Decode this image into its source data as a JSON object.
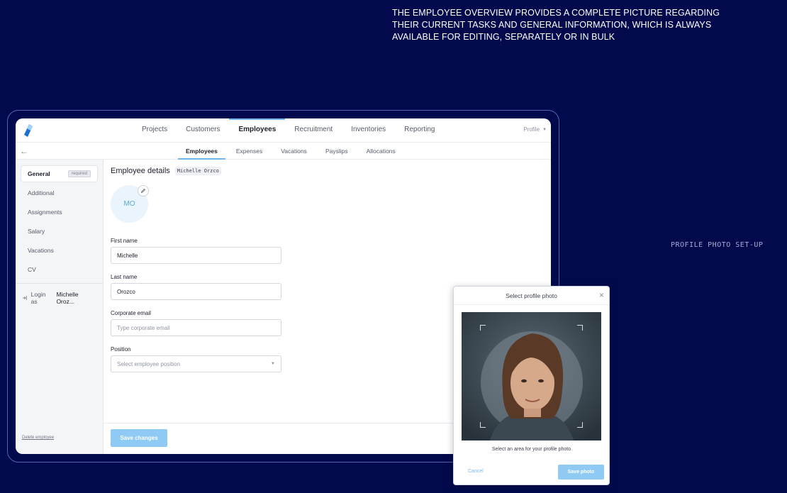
{
  "headline": "THE EMPLOYEE OVERVIEW PROVIDES A COMPLETE PICTURE REGARDING THEIR CURRENT TASKS AND GENERAL INFORMATION, WHICH IS ALWAYS AVAILABLE FOR EDITING, SEPARATELY OR IN BULK",
  "side_caption": "PROFILE PHOTO SET-UP",
  "topnav": {
    "items": [
      "Projects",
      "Customers",
      "Employees",
      "Recruitment",
      "Inventories",
      "Reporting"
    ],
    "active_index": 2,
    "profile_label": "Profile"
  },
  "subnav": {
    "items": [
      "Employees",
      "Expenses",
      "Vacations",
      "Payslips",
      "Allocations"
    ],
    "active_index": 0
  },
  "sidebar": {
    "items": [
      "General",
      "Additional",
      "Assignments",
      "Salary",
      "Vacations",
      "CV"
    ],
    "active_index": 0,
    "general_badge": "required",
    "login_prefix": "Login as",
    "login_name": "Michelle Oroz...",
    "delete_label": "Delete employee"
  },
  "main": {
    "title": "Employee details",
    "tag": "Michelle Orzco",
    "avatar_initials": "MO",
    "first_name": {
      "label": "First name",
      "value": "Michelle"
    },
    "last_name": {
      "label": "Last name",
      "value": "Orozco"
    },
    "email": {
      "label": "Corporate email",
      "placeholder": "Type corporate email"
    },
    "position": {
      "label": "Position",
      "placeholder": "Select employee position"
    },
    "save_label": "Save changes"
  },
  "modal": {
    "title": "Select profile photo",
    "hint": "Select an area for your profile photo",
    "cancel_label": "Cancel",
    "save_label": "Save photo"
  },
  "colors": {
    "background": "#020a4d",
    "accent": "#6fb6ec",
    "button": "#8ecaf4"
  }
}
